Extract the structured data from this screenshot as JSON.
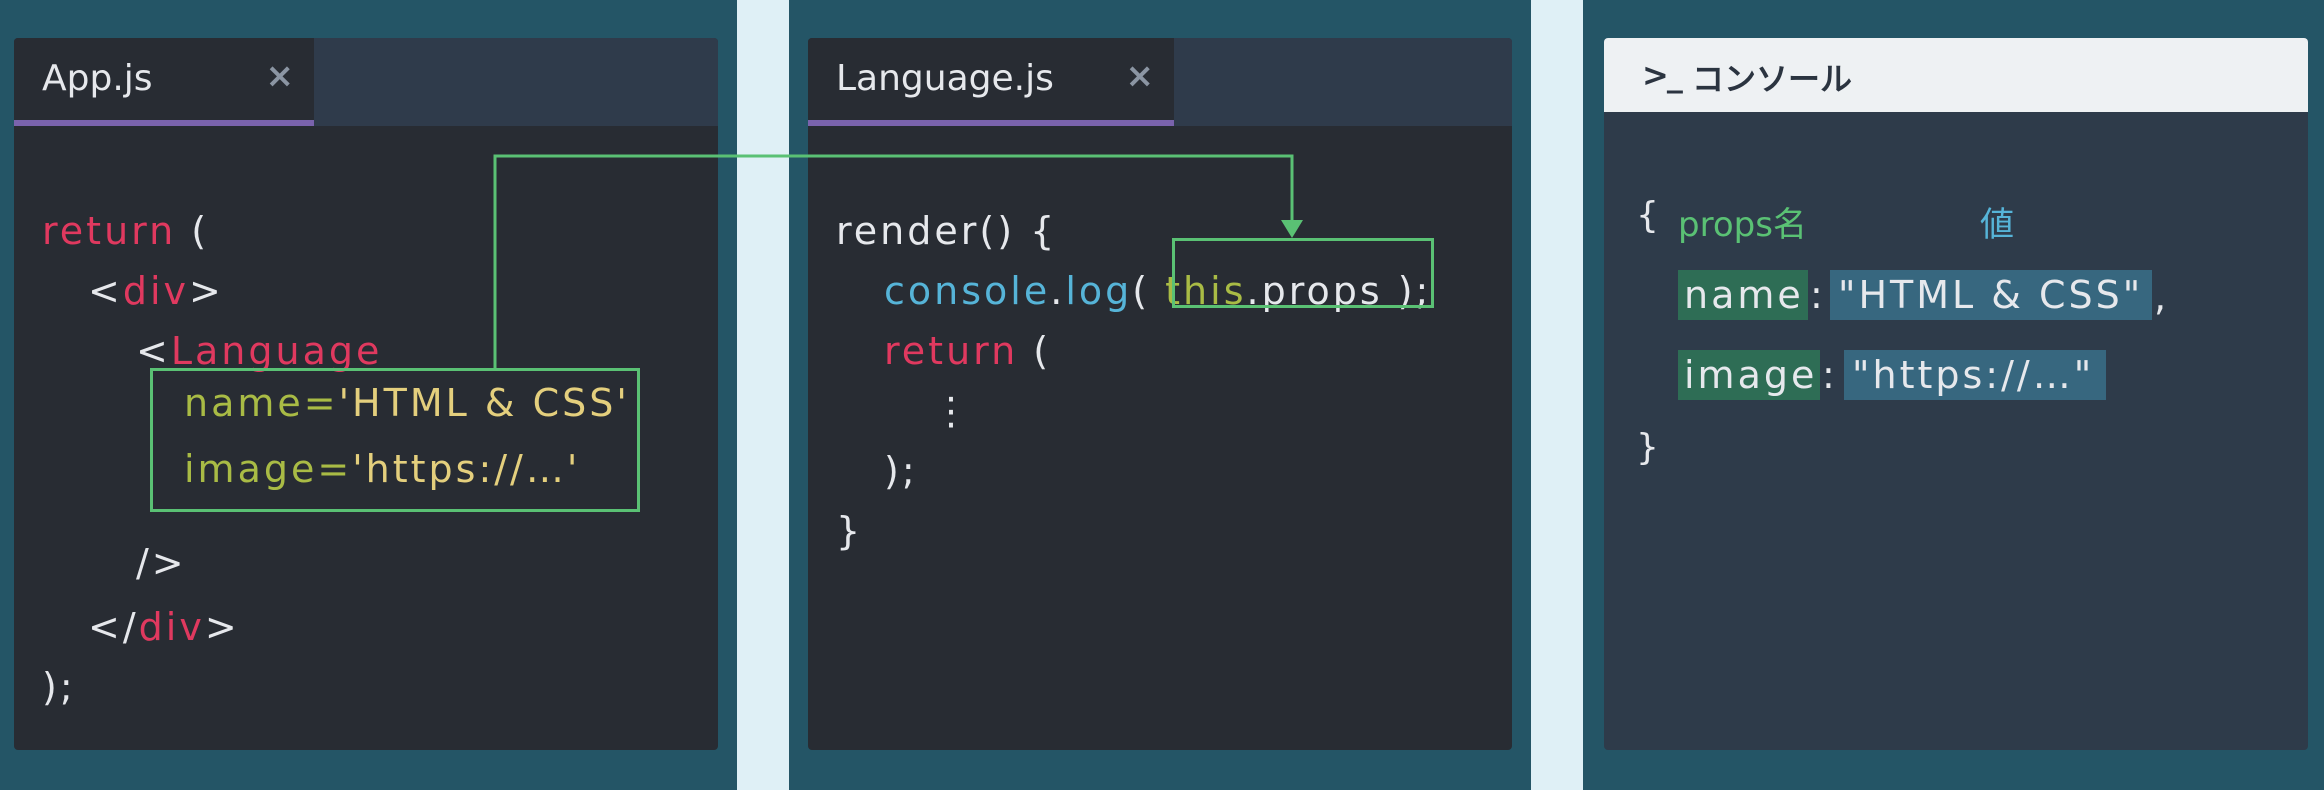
{
  "colors": {
    "background": "#245566",
    "keyword": "#e0395f",
    "attribute": "#a9bb45",
    "string": "#e4cf7d",
    "function": "#56b4d8",
    "highlight": "#5ac174",
    "tab_accent": "#7a63ad"
  },
  "editor1": {
    "tab": "App.js",
    "close": "×",
    "lines": {
      "return_kw": "return",
      "return_paren": " (",
      "div_open_lt": "<",
      "div_open_tag": "div",
      "div_open_gt": ">",
      "lang_lt": "<",
      "lang_tag": "Language",
      "name_attr": "name=",
      "name_val": "'HTML & CSS'",
      "image_attr": "image=",
      "image_val": "'https://…'",
      "self_close": "/>",
      "div_close_lt": "</",
      "div_close_tag": "div",
      "div_close_gt": ">",
      "end": ");"
    }
  },
  "editor2": {
    "tab": "Language.js",
    "close": "×",
    "lines": {
      "render": "render() {",
      "console": "console",
      "dot": ".",
      "log": "log",
      "log_open": "( ",
      "this_kw": "this",
      "props": ".props",
      "log_close": " );",
      "return_kw": "return",
      "return_paren": " (",
      "ellipsis": "⋮",
      "close_paren": ");",
      "close_brace": "}"
    }
  },
  "console": {
    "icon": ">_",
    "title": "コンソール",
    "open_brace": "{",
    "label_key": "props名",
    "label_value": "値",
    "entries": [
      {
        "key": "name",
        "sep": ":",
        "value": "\"HTML & CSS\"",
        "comma": ","
      },
      {
        "key": "image",
        "sep": ":",
        "value": "\"https://…\""
      }
    ],
    "close_brace": "}"
  }
}
